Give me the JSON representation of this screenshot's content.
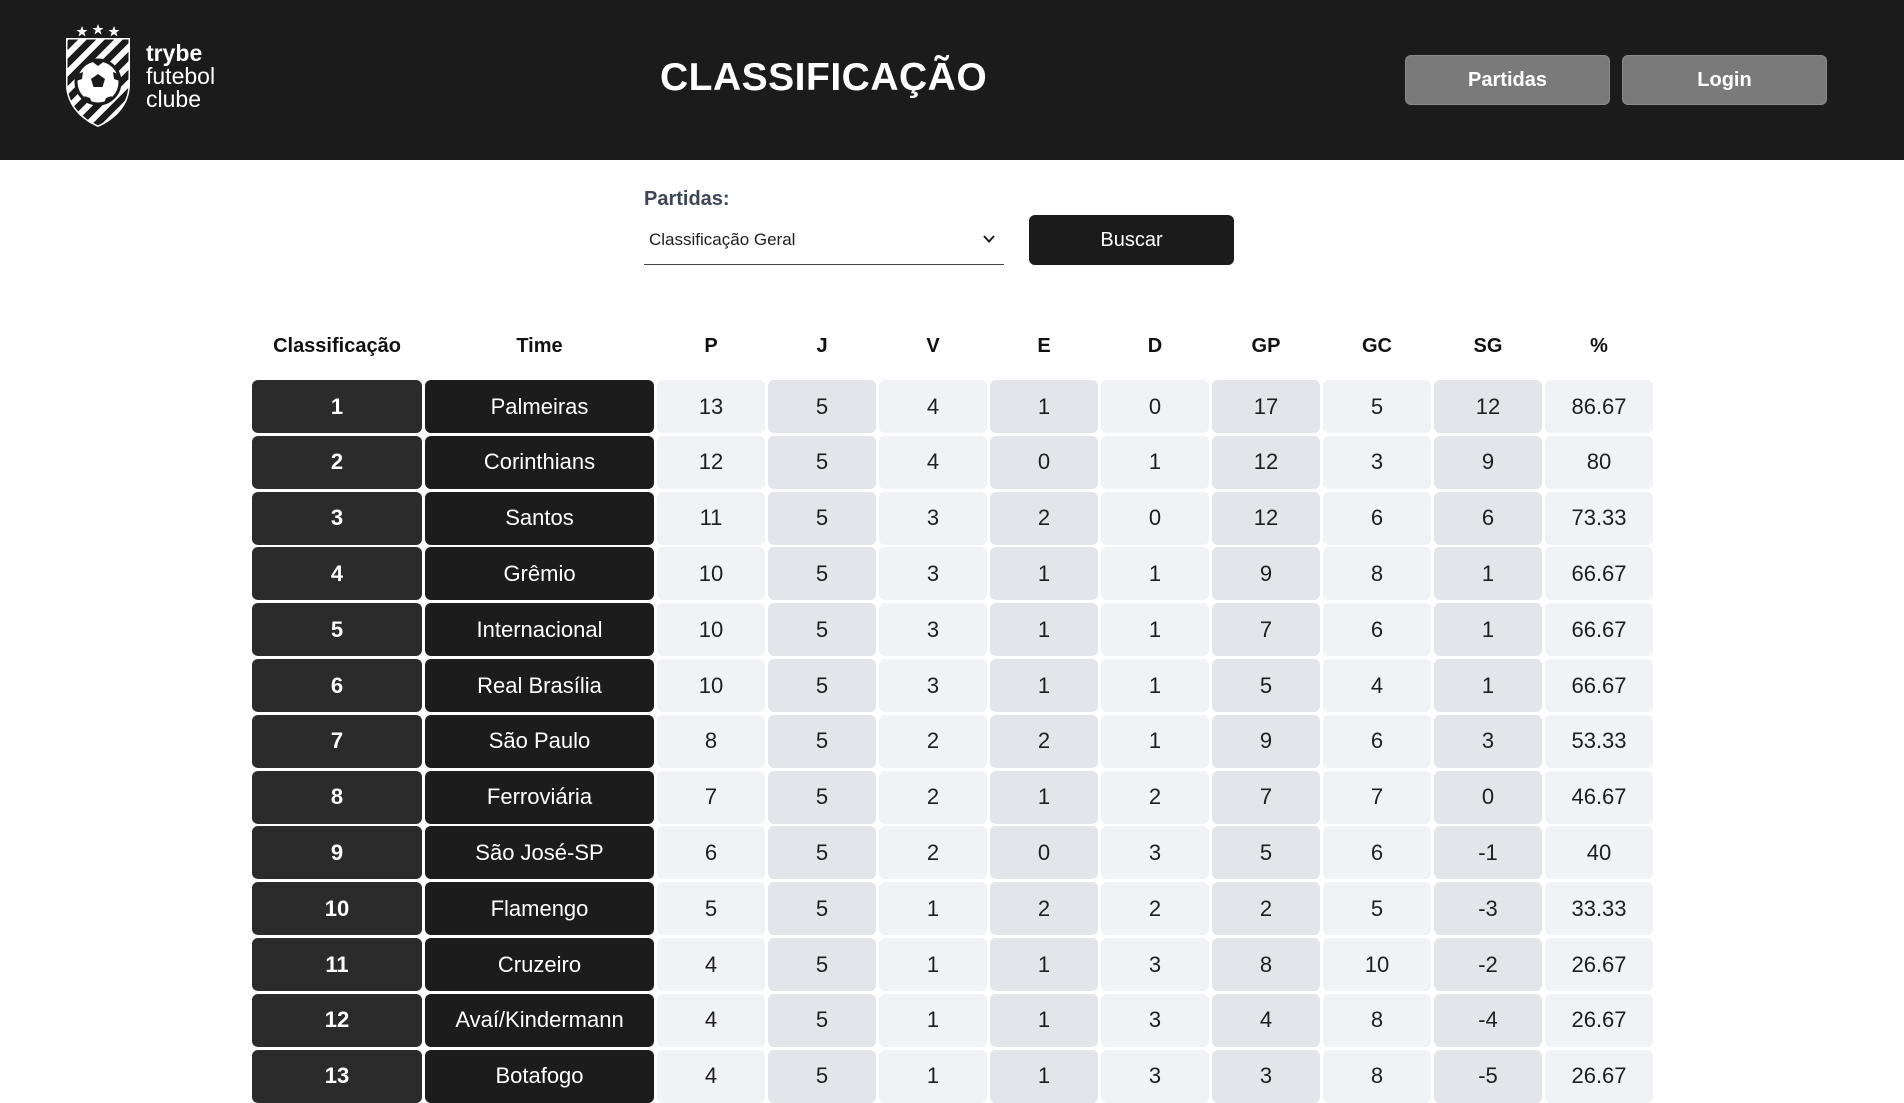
{
  "header": {
    "logo": {
      "line1": "trybe",
      "line2": "futebol",
      "line3": "clube"
    },
    "title": "CLASSIFICAÇÃO",
    "buttons": {
      "matches": "Partidas",
      "login": "Login"
    }
  },
  "filter": {
    "label": "Partidas:",
    "selected": "Classificação Geral",
    "search_button": "Buscar"
  },
  "table": {
    "headers": [
      "Classificação",
      "Time",
      "P",
      "J",
      "V",
      "E",
      "D",
      "GP",
      "GC",
      "SG",
      "%"
    ],
    "rows": [
      [
        "1",
        "Palmeiras",
        "13",
        "5",
        "4",
        "1",
        "0",
        "17",
        "5",
        "12",
        "86.67"
      ],
      [
        "2",
        "Corinthians",
        "12",
        "5",
        "4",
        "0",
        "1",
        "12",
        "3",
        "9",
        "80"
      ],
      [
        "3",
        "Santos",
        "11",
        "5",
        "3",
        "2",
        "0",
        "12",
        "6",
        "6",
        "73.33"
      ],
      [
        "4",
        "Grêmio",
        "10",
        "5",
        "3",
        "1",
        "1",
        "9",
        "8",
        "1",
        "66.67"
      ],
      [
        "5",
        "Internacional",
        "10",
        "5",
        "3",
        "1",
        "1",
        "7",
        "6",
        "1",
        "66.67"
      ],
      [
        "6",
        "Real Brasília",
        "10",
        "5",
        "3",
        "1",
        "1",
        "5",
        "4",
        "1",
        "66.67"
      ],
      [
        "7",
        "São Paulo",
        "8",
        "5",
        "2",
        "2",
        "1",
        "9",
        "6",
        "3",
        "53.33"
      ],
      [
        "8",
        "Ferroviária",
        "7",
        "5",
        "2",
        "1",
        "2",
        "7",
        "7",
        "0",
        "46.67"
      ],
      [
        "9",
        "São José-SP",
        "6",
        "5",
        "2",
        "0",
        "3",
        "5",
        "6",
        "-1",
        "40"
      ],
      [
        "10",
        "Flamengo",
        "5",
        "5",
        "1",
        "2",
        "2",
        "2",
        "5",
        "-3",
        "33.33"
      ],
      [
        "11",
        "Cruzeiro",
        "4",
        "5",
        "1",
        "1",
        "3",
        "8",
        "10",
        "-2",
        "26.67"
      ],
      [
        "12",
        "Avaí/Kindermann",
        "4",
        "5",
        "1",
        "1",
        "3",
        "4",
        "8",
        "-4",
        "26.67"
      ],
      [
        "13",
        "Botafogo",
        "4",
        "5",
        "1",
        "1",
        "3",
        "3",
        "8",
        "-5",
        "26.67"
      ]
    ]
  },
  "colors": {
    "header_bg": "#1b1b1b",
    "nav_button_bg": "#7a7a7a",
    "rank_cell_bg": "#2b2b2b",
    "team_cell_bg": "#1c1c1c",
    "light_cell_bg": "#f1f2f5",
    "mid_cell_bg": "#e3e5ea"
  }
}
